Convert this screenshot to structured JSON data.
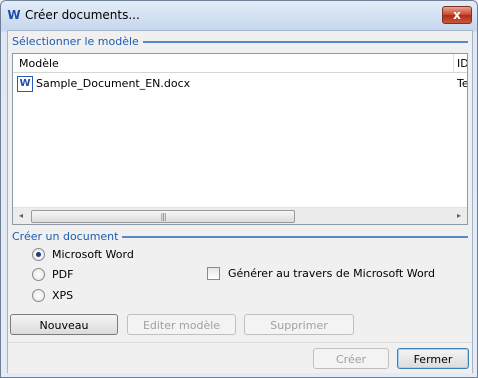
{
  "window": {
    "title": "Créer documents...",
    "close_glyph": "x"
  },
  "template_section": {
    "header": "Sélectionner le modèle",
    "columns": [
      "Modèle",
      "ID"
    ],
    "rows": [
      {
        "name": "Sample_Document_EN.docx",
        "id": "Tec"
      }
    ],
    "scroll_left": "◂",
    "scroll_right": "▸",
    "scroll_grip": "|||"
  },
  "create_section": {
    "header": "Créer un document",
    "options": [
      {
        "label": "Microsoft Word",
        "checked": true
      },
      {
        "label": "PDF",
        "checked": false
      },
      {
        "label": "XPS",
        "checked": false
      }
    ],
    "checkbox_label": "Générer au travers de Microsoft Word",
    "checkbox_checked": false
  },
  "template_buttons": {
    "new": "Nouveau",
    "edit": "Editer modèle",
    "delete": "Supprimer"
  },
  "footer_buttons": {
    "create": "Créer",
    "close": "Fermer"
  },
  "icons": {
    "app": "word-doc-icon",
    "file": "word-file-icon"
  }
}
